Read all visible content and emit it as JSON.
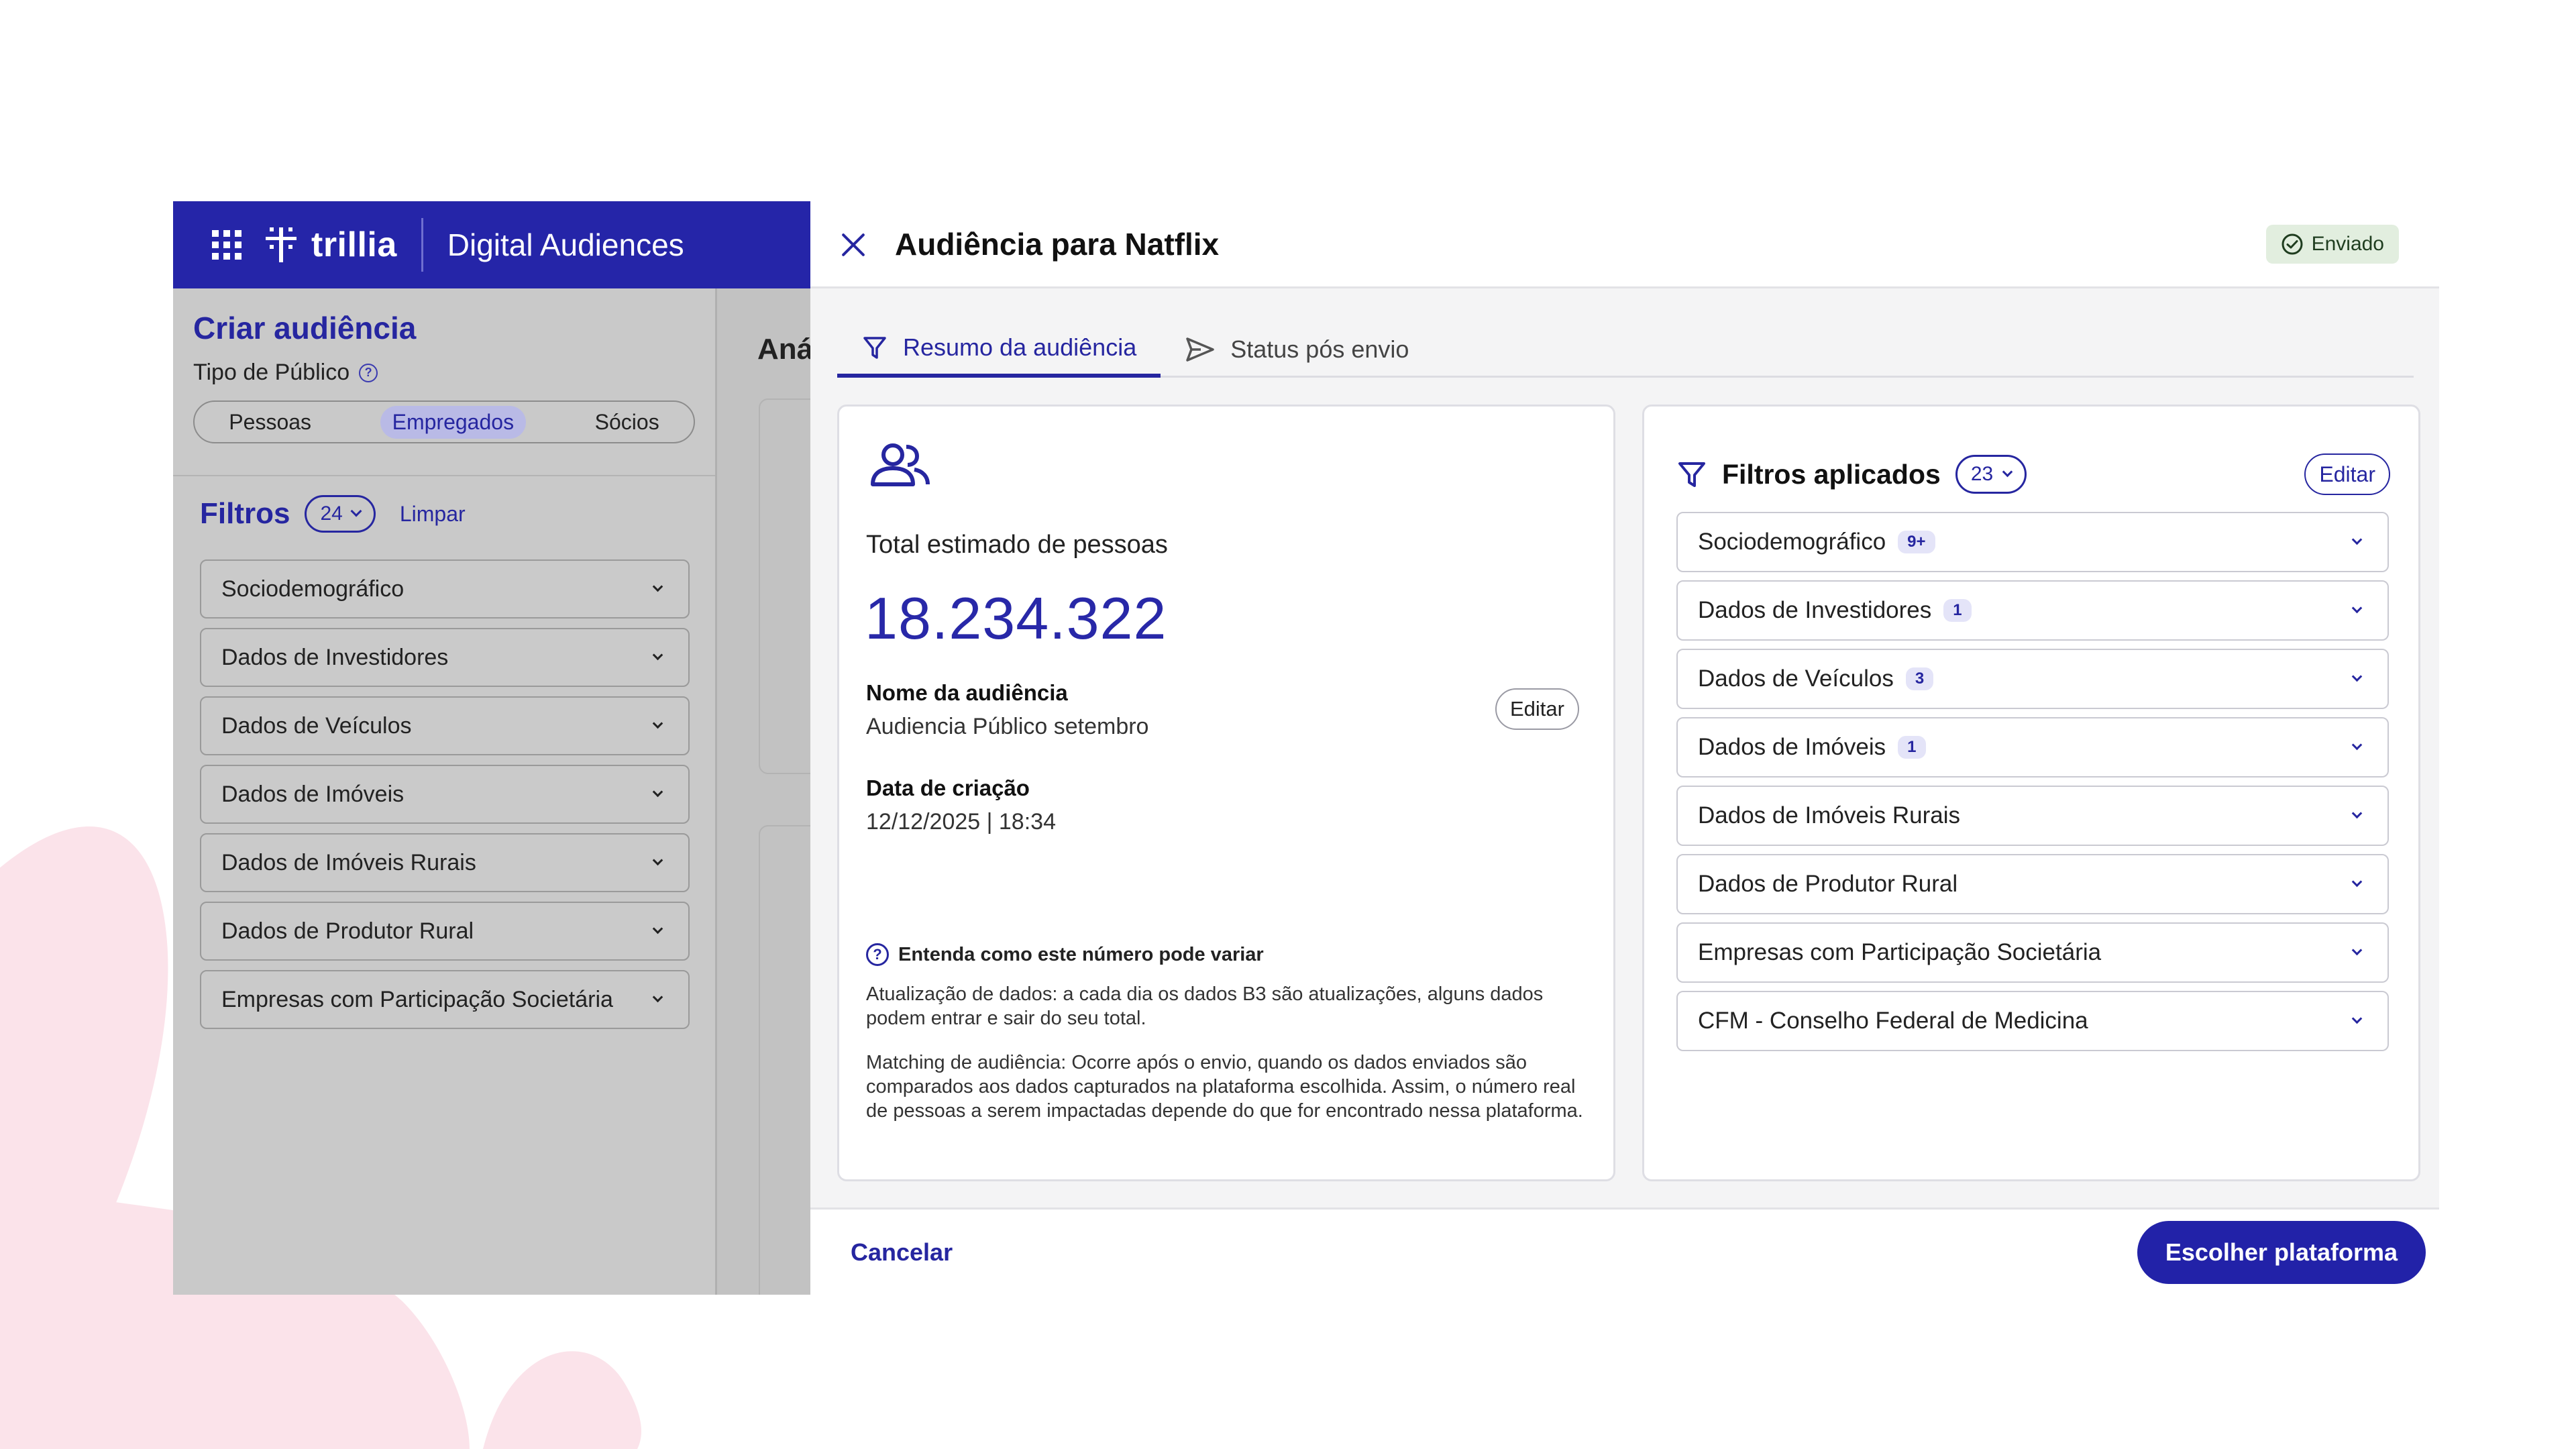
{
  "colors": {
    "brand": "#2525a8",
    "accent": "#2626a0",
    "success_bg": "#e2eedf"
  },
  "header": {
    "logo_text": "trillia",
    "app_title": "Digital Audiences"
  },
  "sidebar": {
    "title": "Criar audiência",
    "audience_type_label": "Tipo de Público",
    "segments": [
      "Pessoas",
      "Empregados",
      "Sócios"
    ],
    "selected_segment": "Empregados",
    "filters_title": "Filtros",
    "filters_count": "24",
    "clear_label": "Limpar",
    "items": [
      {
        "label": "Sociodemográfico"
      },
      {
        "label": "Dados de Investidores"
      },
      {
        "label": "Dados de Veículos"
      },
      {
        "label": "Dados de Imóveis"
      },
      {
        "label": "Dados de Imóveis Rurais"
      },
      {
        "label": "Dados de Produtor Rural"
      },
      {
        "label": "Empresas com Participação Societária"
      }
    ]
  },
  "center": {
    "title_partial": "Aná"
  },
  "modal": {
    "title": "Audiência para Natflix",
    "status": "Enviado",
    "tabs": [
      {
        "label": "Resumo da audiência",
        "icon": "filter-icon"
      },
      {
        "label": "Status pós envio",
        "icon": "send-icon"
      }
    ],
    "summary": {
      "total_label": "Total estimado de pessoas",
      "total_value": "18.234.322",
      "name_label": "Nome da audiência",
      "name_value": "Audiencia Público setembro",
      "edit_label": "Editar",
      "date_label": "Data de criação",
      "date_value": "12/12/2025 | 18:34",
      "info_title": "Entenda como este número pode variar",
      "info_update": "Atualização de dados: a cada dia os dados B3 são atualizações, alguns dados podem entrar e sair do seu total.",
      "info_matching": "Matching de audiência: Ocorre após o envio, quando os dados enviados são comparados aos dados capturados na plataforma escolhida. Assim, o número real de pessoas a serem impactadas depende do que for encontrado nessa plataforma."
    },
    "filters": {
      "title": "Filtros aplicados",
      "count": "23",
      "edit_label": "Editar",
      "items": [
        {
          "label": "Sociodemográfico",
          "badge": "9+"
        },
        {
          "label": "Dados de Investidores",
          "badge": "1"
        },
        {
          "label": "Dados de Veículos",
          "badge": "3"
        },
        {
          "label": "Dados de Imóveis",
          "badge": "1"
        },
        {
          "label": "Dados de Imóveis Rurais",
          "badge": ""
        },
        {
          "label": "Dados de Produtor Rural",
          "badge": ""
        },
        {
          "label": "Empresas com Participação Societária",
          "badge": ""
        },
        {
          "label": "CFM - Conselho Federal de Medicina",
          "badge": ""
        }
      ]
    },
    "footer": {
      "cancel_label": "Cancelar",
      "primary_label": "Escolher plataforma"
    }
  }
}
